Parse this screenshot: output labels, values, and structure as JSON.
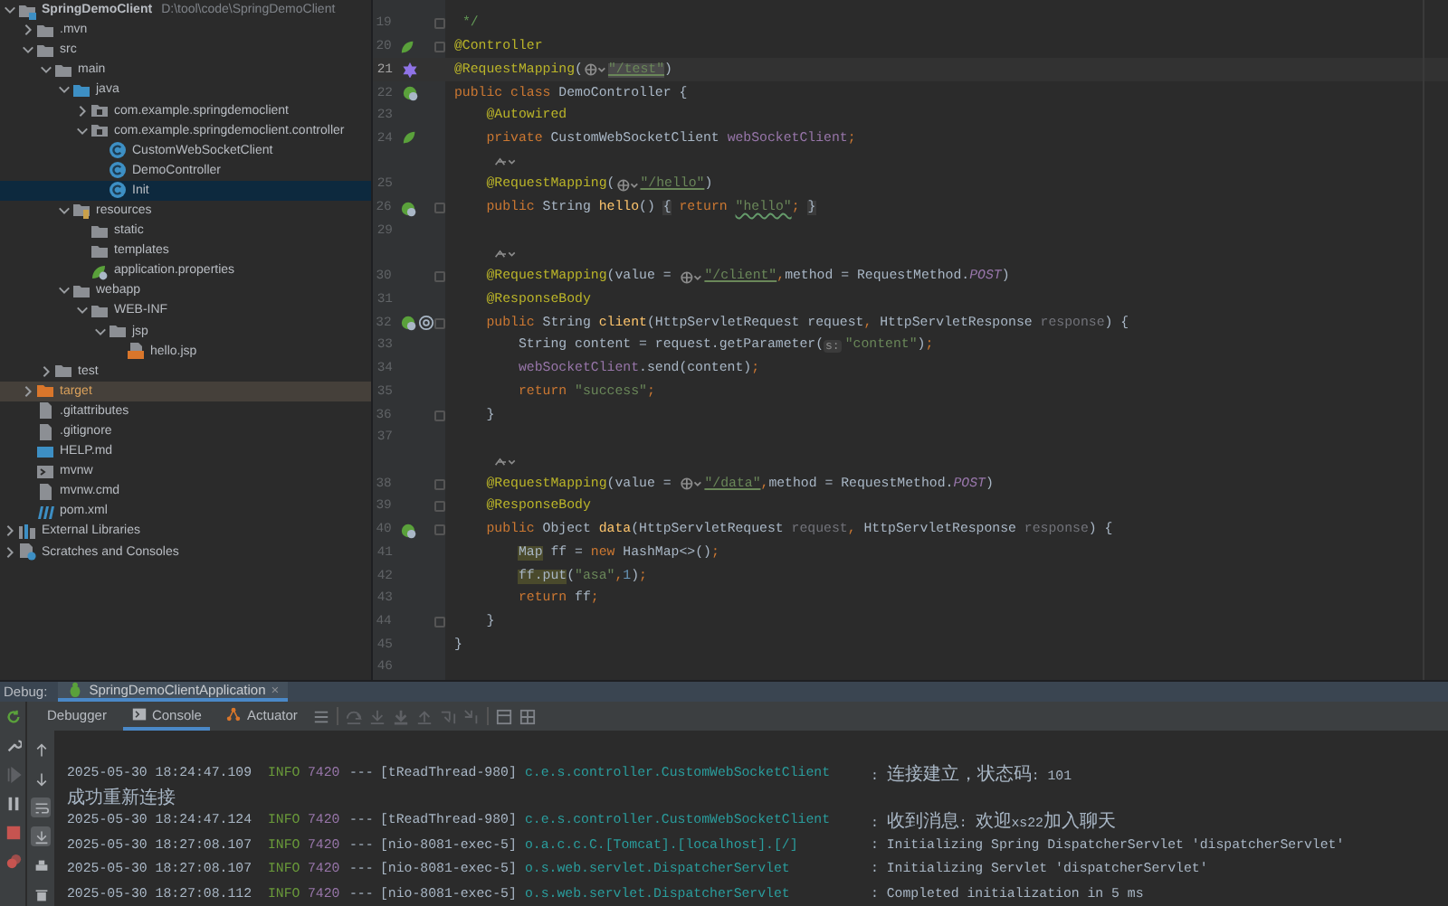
{
  "project_tree": [
    {
      "label": "SpringDemoClient",
      "path": "D:\\tool\\code\\SpringDemoClient",
      "kind": "module",
      "expanded": true,
      "selected": false,
      "children": [
        {
          "label": ".mvn",
          "kind": "folder",
          "expanded": false,
          "selected": false
        },
        {
          "label": "src",
          "kind": "folder",
          "expanded": true,
          "selected": false,
          "children": [
            {
              "label": "main",
              "kind": "folder",
              "expanded": true,
              "selected": false,
              "children": [
                {
                  "label": "java",
                  "kind": "src-folder",
                  "expanded": true,
                  "selected": false,
                  "children": [
                    {
                      "label": "com.example.springdemoclient",
                      "kind": "package",
                      "expanded": false,
                      "selected": false
                    },
                    {
                      "label": "com.example.springdemoclient.controller",
                      "kind": "package",
                      "expanded": true,
                      "selected": false,
                      "children": [
                        {
                          "label": "CustomWebSocketClient",
                          "kind": "class",
                          "selected": false
                        },
                        {
                          "label": "DemoController",
                          "kind": "class",
                          "selected": false
                        },
                        {
                          "label": "Init",
                          "kind": "class",
                          "selected": true
                        }
                      ]
                    }
                  ]
                },
                {
                  "label": "resources",
                  "kind": "resources-folder",
                  "expanded": true,
                  "selected": false,
                  "children": [
                    {
                      "label": "static",
                      "kind": "folder",
                      "selected": false
                    },
                    {
                      "label": "templates",
                      "kind": "folder",
                      "selected": false
                    },
                    {
                      "label": "application.properties",
                      "kind": "properties",
                      "selected": false
                    }
                  ]
                },
                {
                  "label": "webapp",
                  "kind": "folder",
                  "expanded": true,
                  "selected": false,
                  "children": [
                    {
                      "label": "WEB-INF",
                      "kind": "folder",
                      "expanded": true,
                      "selected": false,
                      "children": [
                        {
                          "label": "jsp",
                          "kind": "folder",
                          "expanded": true,
                          "selected": false,
                          "children": [
                            {
                              "label": "hello.jsp",
                              "kind": "jsp",
                              "selected": false
                            }
                          ]
                        }
                      ]
                    }
                  ]
                }
              ]
            },
            {
              "label": "test",
              "kind": "folder",
              "expanded": false,
              "selected": false
            }
          ]
        },
        {
          "label": "target",
          "kind": "excluded",
          "expanded": false,
          "selected": false
        },
        {
          "label": ".gitattributes",
          "kind": "file",
          "selected": false
        },
        {
          "label": ".gitignore",
          "kind": "file",
          "selected": false
        },
        {
          "label": "HELP.md",
          "kind": "md",
          "selected": false
        },
        {
          "label": "mvnw",
          "kind": "script",
          "selected": false
        },
        {
          "label": "mvnw.cmd",
          "kind": "file",
          "selected": false
        },
        {
          "label": "pom.xml",
          "kind": "maven",
          "selected": false
        }
      ]
    },
    {
      "label": "External Libraries",
      "kind": "libraries",
      "expanded": false,
      "selected": false
    },
    {
      "label": "Scratches and Consoles",
      "kind": "scratches",
      "expanded": false,
      "selected": false
    }
  ],
  "editor": {
    "lines": [
      {
        "number": "19",
        "fold": true,
        "tokens": [
          {
            "text": " */",
            "kind": "comment"
          }
        ]
      },
      {
        "number": "20",
        "gutter_icon": {
          "kind": "bean"
        },
        "fold": true,
        "tokens": [
          {
            "text": "@Controller",
            "kind": "ann"
          }
        ]
      },
      {
        "number": "21",
        "gutter_icon": {
          "kind": "mapping"
        },
        "current": true,
        "tokens": [
          {
            "text": "@RequestMapping",
            "kind": "ann"
          },
          {
            "text": "(",
            "kind": "plain"
          },
          {
            "kind": "globe"
          },
          {
            "text": "\"/test\"",
            "kind": "url-hl"
          },
          {
            "text": ")",
            "kind": "plain"
          }
        ]
      },
      {
        "number": "22",
        "gutter_icon": {
          "kind": "bean-web"
        },
        "tokens": [
          {
            "text": "public class ",
            "kind": "kw"
          },
          {
            "text": "DemoController {",
            "kind": "plain"
          }
        ]
      },
      {
        "number": "23",
        "tokens": [
          {
            "text": "    @Autowired",
            "kind": "ann"
          }
        ]
      },
      {
        "number": "24",
        "gutter_icon": {
          "kind": "bean"
        },
        "tokens": [
          {
            "text": "    private ",
            "kind": "kw"
          },
          {
            "text": "CustomWebSocketClient ",
            "kind": "plain"
          },
          {
            "text": "webSocketClient",
            "kind": "field"
          },
          {
            "text": ";",
            "kind": "kw"
          }
        ]
      },
      {
        "kind": "inlay"
      },
      {
        "number": "25",
        "tokens": [
          {
            "text": "    @RequestMapping",
            "kind": "ann"
          },
          {
            "text": "(",
            "kind": "plain"
          },
          {
            "kind": "globe"
          },
          {
            "text": "\"/hello\"",
            "kind": "url"
          },
          {
            "text": ")",
            "kind": "plain"
          }
        ]
      },
      {
        "number": "26",
        "gutter_icon": {
          "kind": "web"
        },
        "fold": true,
        "tokens": [
          {
            "text": "    public ",
            "kind": "kw"
          },
          {
            "text": "String ",
            "kind": "plain"
          },
          {
            "text": "hello",
            "kind": "method"
          },
          {
            "text": "() ",
            "kind": "plain"
          },
          {
            "text": "{",
            "kind": "folded"
          },
          {
            "text": " return ",
            "kind": "kw"
          },
          {
            "text": "\"hello\"",
            "kind": "str-typo"
          },
          {
            "text": ";",
            "kind": "kw"
          },
          {
            "text": " }",
            "kind": "folded"
          }
        ]
      },
      {
        "number": "29"
      },
      {
        "kind": "inlay"
      },
      {
        "number": "30",
        "fold": true,
        "tokens": [
          {
            "text": "    @RequestMapping",
            "kind": "ann"
          },
          {
            "text": "(value = ",
            "kind": "plain"
          },
          {
            "kind": "globe"
          },
          {
            "text": "\"/client\"",
            "kind": "url"
          },
          {
            "text": ",",
            "kind": "kw"
          },
          {
            "text": "method = RequestMethod.",
            "kind": "plain"
          },
          {
            "text": "POST",
            "kind": "const"
          },
          {
            "text": ")",
            "kind": "plain"
          }
        ]
      },
      {
        "number": "31",
        "tokens": [
          {
            "text": "    @ResponseBody",
            "kind": "ann"
          }
        ]
      },
      {
        "number": "32",
        "gutter_icon": {
          "kind": "web-at"
        },
        "fold": true,
        "tokens": [
          {
            "text": "    public ",
            "kind": "kw"
          },
          {
            "text": "String ",
            "kind": "plain"
          },
          {
            "text": "client",
            "kind": "method"
          },
          {
            "text": "(HttpServletRequest request",
            "kind": "plain"
          },
          {
            "text": ", ",
            "kind": "kw"
          },
          {
            "text": "HttpServletResponse ",
            "kind": "plain"
          },
          {
            "text": "response",
            "kind": "param"
          },
          {
            "text": ") {",
            "kind": "plain"
          }
        ]
      },
      {
        "number": "33",
        "tokens": [
          {
            "text": "        String content = request.getParameter(",
            "kind": "plain"
          },
          {
            "text": "s:",
            "kind": "hint"
          },
          {
            "text": "\"content\"",
            "kind": "str"
          },
          {
            "text": ")",
            "kind": "plain"
          },
          {
            "text": ";",
            "kind": "kw"
          }
        ]
      },
      {
        "number": "34",
        "tokens": [
          {
            "text": "        webSocketClient",
            "kind": "field"
          },
          {
            "text": ".send(content)",
            "kind": "plain"
          },
          {
            "text": ";",
            "kind": "kw"
          }
        ]
      },
      {
        "number": "35",
        "tokens": [
          {
            "text": "        return ",
            "kind": "kw"
          },
          {
            "text": "\"success\"",
            "kind": "str"
          },
          {
            "text": ";",
            "kind": "kw"
          }
        ]
      },
      {
        "number": "36",
        "fold": true,
        "tokens": [
          {
            "text": "    }",
            "kind": "plain"
          }
        ]
      },
      {
        "number": "37"
      },
      {
        "kind": "inlay"
      },
      {
        "number": "38",
        "fold": true,
        "tokens": [
          {
            "text": "    @RequestMapping",
            "kind": "ann"
          },
          {
            "text": "(value = ",
            "kind": "plain"
          },
          {
            "kind": "globe"
          },
          {
            "text": "\"/data\"",
            "kind": "url"
          },
          {
            "text": ",",
            "kind": "kw"
          },
          {
            "text": "method = RequestMethod.",
            "kind": "plain"
          },
          {
            "text": "POST",
            "kind": "const"
          },
          {
            "text": ")",
            "kind": "plain"
          }
        ]
      },
      {
        "number": "39",
        "fold": true,
        "tokens": [
          {
            "text": "    @ResponseBody",
            "kind": "ann"
          }
        ]
      },
      {
        "number": "40",
        "gutter_icon": {
          "kind": "web"
        },
        "fold": true,
        "tokens": [
          {
            "text": "    public ",
            "kind": "kw"
          },
          {
            "text": "Object ",
            "kind": "plain"
          },
          {
            "text": "data",
            "kind": "method"
          },
          {
            "text": "(HttpServletRequest ",
            "kind": "plain"
          },
          {
            "text": "request",
            "kind": "param"
          },
          {
            "text": ", ",
            "kind": "kw"
          },
          {
            "text": "HttpServletResponse ",
            "kind": "plain"
          },
          {
            "text": "response",
            "kind": "param"
          },
          {
            "text": ") {",
            "kind": "plain"
          }
        ]
      },
      {
        "number": "41",
        "tokens": [
          {
            "text": "        Map",
            "kind": "warn"
          },
          {
            "text": " ff = ",
            "kind": "plain"
          },
          {
            "text": "new ",
            "kind": "kw"
          },
          {
            "text": "HashMap<>()",
            "kind": "plain"
          },
          {
            "text": ";",
            "kind": "kw"
          }
        ]
      },
      {
        "number": "42",
        "tokens": [
          {
            "text": "        ff.put",
            "kind": "warn"
          },
          {
            "text": "(",
            "kind": "plain"
          },
          {
            "text": "\"asa\"",
            "kind": "str"
          },
          {
            "text": ",",
            "kind": "kw"
          },
          {
            "text": "1",
            "kind": "num"
          },
          {
            "text": ")",
            "kind": "plain"
          },
          {
            "text": ";",
            "kind": "kw"
          }
        ]
      },
      {
        "number": "43",
        "tokens": [
          {
            "text": "        return ",
            "kind": "kw"
          },
          {
            "text": "ff",
            "kind": "plain"
          },
          {
            "text": ";",
            "kind": "kw"
          }
        ]
      },
      {
        "number": "44",
        "fold": true,
        "tokens": [
          {
            "text": "    }",
            "kind": "plain"
          }
        ]
      },
      {
        "number": "45",
        "tokens": [
          {
            "text": "}",
            "kind": "plain"
          }
        ]
      },
      {
        "number": "46"
      }
    ]
  },
  "debug": {
    "label": "Debug:",
    "tab": {
      "title": "SpringDemoClientApplication",
      "close": "×"
    },
    "tabs": [
      {
        "label": "Debugger",
        "selected": false
      },
      {
        "label": "Console",
        "kind": "console",
        "selected": true
      },
      {
        "label": "Actuator",
        "kind": "actuator",
        "selected": false
      }
    ],
    "side_toggles": [
      {
        "kind": "up",
        "selected": false
      },
      {
        "kind": "down",
        "selected": false
      },
      {
        "kind": "wrap",
        "selected": true
      },
      {
        "kind": "scroll-end",
        "selected": true
      },
      {
        "kind": "print",
        "selected": false
      },
      {
        "kind": "trash",
        "selected": false
      }
    ],
    "console": [
      {
        "kind": "log",
        "time": "2025-05-30 18:24:47.109",
        "level": "INFO",
        "pid": "7420",
        "sep": "---",
        "thread": "[tReadThread-980]",
        "logger": "c.e.s.controller.CustomWebSocketClient",
        "message": ": 连接建立，状态码: 101"
      },
      {
        "kind": "text",
        "text": "成功重新连接"
      },
      {
        "kind": "log",
        "time": "2025-05-30 18:24:47.124",
        "level": "INFO",
        "pid": "7420",
        "sep": "---",
        "thread": "[tReadThread-980]",
        "logger": "c.e.s.controller.CustomWebSocketClient",
        "message": ": 收到消息: 欢迎xs22加入聊天"
      },
      {
        "kind": "log",
        "time": "2025-05-30 18:27:08.107",
        "level": "INFO",
        "pid": "7420",
        "sep": "---",
        "thread": "[nio-8081-exec-5]",
        "logger": "o.a.c.c.C.[Tomcat].[localhost].[/]",
        "message": ": Initializing Spring DispatcherServlet 'dispatcherServlet'"
      },
      {
        "kind": "log",
        "time": "2025-05-30 18:27:08.107",
        "level": "INFO",
        "pid": "7420",
        "sep": "---",
        "thread": "[nio-8081-exec-5]",
        "logger": "o.s.web.servlet.DispatcherServlet",
        "message": ": Initializing Servlet 'dispatcherServlet'"
      },
      {
        "kind": "log",
        "time": "2025-05-30 18:27:08.112",
        "level": "INFO",
        "pid": "7420",
        "sep": "---",
        "thread": "[nio-8081-exec-5]",
        "logger": "o.s.web.servlet.DispatcherServlet",
        "message": ": Completed initialization in 5 ms"
      }
    ]
  }
}
